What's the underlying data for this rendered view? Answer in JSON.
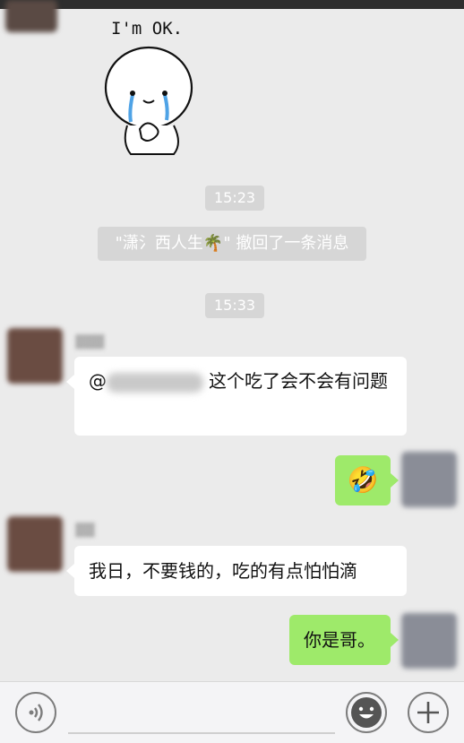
{
  "sticker": {
    "text": "I'm OK."
  },
  "timestamps": [
    "15:23",
    "15:33"
  ],
  "system_notice": "\"潇氵西人生🌴\" 撤回了一条消息",
  "messages": {
    "m1": {
      "prefix": "@",
      "text": "这个吃了会不会有问题"
    },
    "m2": {
      "emoji": "🤣"
    },
    "m3": {
      "text": "我日，不要钱的，吃的有点怕怕滴"
    },
    "m4": {
      "text": "你是哥。"
    }
  },
  "colors": {
    "background": "#ebebeb",
    "bubble_incoming": "#ffffff",
    "bubble_outgoing": "#9eea6a",
    "timestamp_chip": "#d6d6d6"
  },
  "bottom_bar": {
    "voice_button_icon": "voice-icon",
    "emoji_button_icon": "smiley-icon",
    "more_button_icon": "plus-icon"
  }
}
